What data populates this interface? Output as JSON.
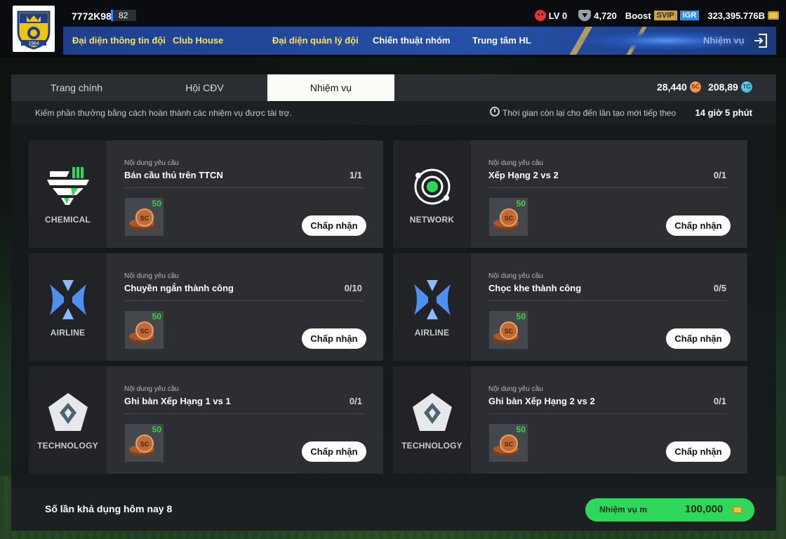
{
  "header": {
    "team_id": "7772K98",
    "team_ovr": "82",
    "level": "LV 0",
    "rank_points": "4,720",
    "boost_label": "Boost",
    "svip_label": "SVIP",
    "igr_label": "IGR",
    "balance": "323,395.776B",
    "nav": [
      {
        "label": "Đại diện thông tin đội"
      },
      {
        "label": "Club House"
      },
      {
        "label": "Đại diện quản lý đội"
      },
      {
        "label": "Chiến thuật nhóm"
      },
      {
        "label": "Trung tâm HL"
      },
      {
        "label": "Nhiệm vụ"
      }
    ]
  },
  "tabs": [
    {
      "label": "Trang chính"
    },
    {
      "label": "Hội CĐV"
    },
    {
      "label": "Nhiệm vụ",
      "active": true
    }
  ],
  "currencies": {
    "sc_amount": "28,440",
    "sc_icon_text": "SC",
    "tc_amount": "208,89",
    "tc_icon_text": "TC"
  },
  "info": {
    "description": "Kiếm phần thưởng bằng cách hoàn thành các nhiệm vụ được tài trợ.",
    "timer_label": "Thời gian còn lại cho đến lần tạo mới tiếp theo",
    "timer_value": "14 giờ 5 phút"
  },
  "missions": [
    {
      "sponsor": "CHEMICAL",
      "req_label": "Nội dung yêu cầu",
      "requirement": "Bán cầu thủ trên TTCN",
      "progress": "1/1",
      "reward": "50",
      "reward_coin_text": "SC",
      "button": "Chấp nhận"
    },
    {
      "sponsor": "NETWORK",
      "req_label": "Nội dung yêu cầu",
      "requirement": "Xếp Hạng 2 vs 2",
      "progress": "0/1",
      "reward": "50",
      "reward_coin_text": "SC",
      "button": "Chấp nhận"
    },
    {
      "sponsor": "AIRLINE",
      "req_label": "Nội dung yêu cầu",
      "requirement": "Chuyền ngắn thành công",
      "progress": "0/10",
      "reward": "50",
      "reward_coin_text": "SC",
      "button": "Chấp nhận"
    },
    {
      "sponsor": "AIRLINE",
      "req_label": "Nội dung yêu cầu",
      "requirement": "Chọc khe thành công",
      "progress": "0/5",
      "reward": "50",
      "reward_coin_text": "SC",
      "button": "Chấp nhận"
    },
    {
      "sponsor": "TECHNOLOGY",
      "req_label": "Nội dung yêu cầu",
      "requirement": "Ghi bàn Xếp Hạng 1 vs 1",
      "progress": "0/1",
      "reward": "50",
      "reward_coin_text": "SC",
      "button": "Chấp nhận"
    },
    {
      "sponsor": "TECHNOLOGY",
      "req_label": "Nội dung yêu cầu",
      "requirement": "Ghi bàn Xếp Hạng 2 vs 2",
      "progress": "0/1",
      "reward": "50",
      "reward_coin_text": "SC",
      "button": "Chấp nhận"
    }
  ],
  "footer": {
    "daily_label": "Số lần khả dụng hôm nay 8",
    "refresh_label": "Nhiệm vụ m",
    "refresh_cost": "100,000"
  },
  "club_logo_year": "1964",
  "colors": {
    "nav_highlight": "#ffe44a",
    "accept_button": "#ffffff",
    "refresh_button": "#2fd85a",
    "reward_amount": "#3ed24b",
    "chemical_green": "#2fd85a"
  }
}
